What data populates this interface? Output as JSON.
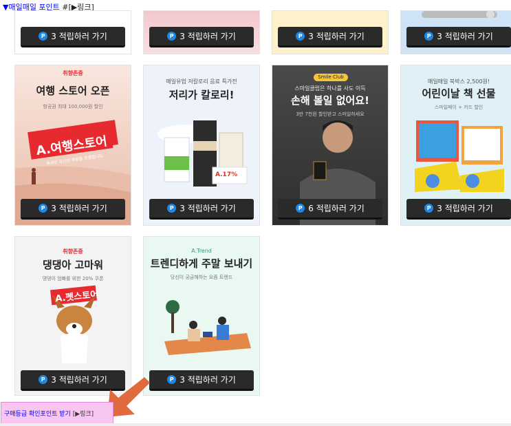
{
  "header": {
    "link": "▼매일매일 포인트",
    "hash": "#",
    "tag": "[▶링크]"
  },
  "cards": [
    {
      "id": "top1",
      "bg": "#ffffff",
      "points": "3"
    },
    {
      "id": "top2",
      "bg": "#f6d3d8",
      "points": "3"
    },
    {
      "id": "top3",
      "bg": "#fff1c9",
      "points": "3"
    },
    {
      "id": "top4",
      "bg": "#cfe3f7",
      "points": "3"
    },
    {
      "id": "travel",
      "bg": "#f7ddd6",
      "brand": "취향존중",
      "title": "여행 스토어 오픈",
      "subtitle": "항공권 최대 100,000원 할인",
      "banner": "A.여행스토어",
      "banner_small": "복세편 당신의 취향을 존중합니다",
      "points": "3"
    },
    {
      "id": "milk",
      "bg": "#eef2fb",
      "brand": "매일유업 저칼로리 음료 특가전",
      "title": "저리가 칼로리!",
      "tag": "A.17%",
      "points": "3"
    },
    {
      "id": "smileclub",
      "bg": "#3a3a3a",
      "brand": "Smile Club",
      "brand_line": "스마일클럽은 하나를 사도 이득",
      "title": "손해 볼일 없어요!",
      "subtitle": "3만 7천원 할인받고 스마일하세요",
      "points": "6"
    },
    {
      "id": "books",
      "bg": "#dff0f7",
      "brand": "매일매일 북박스 2,500원!",
      "title": "어린이날 책 선물",
      "subtitle": "스마일페이 + 카드 할인",
      "points": "3"
    },
    {
      "id": "pet",
      "bg": "#f3f3f3",
      "brand": "취향존중",
      "title": "댕댕아 고마워",
      "subtitle": "댕댕이 엄빠를 위한 20% 쿠폰",
      "banner": "A.펫스토어",
      "points": "3"
    },
    {
      "id": "trend",
      "bg": "#e9f8f1",
      "brand": "A.Trend",
      "title": "트렌디하게 주말 보내기",
      "subtitle": "당신이 궁금해하는 요즘 트렌드",
      "points": "3"
    }
  ],
  "button": {
    "label_suffix": "적립하러 가기",
    "p_glyph": "P"
  },
  "footer": {
    "link": "구매등급 확인포인트 받기",
    "tag": "[▶링크]"
  },
  "colors": {
    "accent_arrow": "#e06a3c",
    "badge": "#1e88e5",
    "footer_bg": "#f8c6f0"
  }
}
